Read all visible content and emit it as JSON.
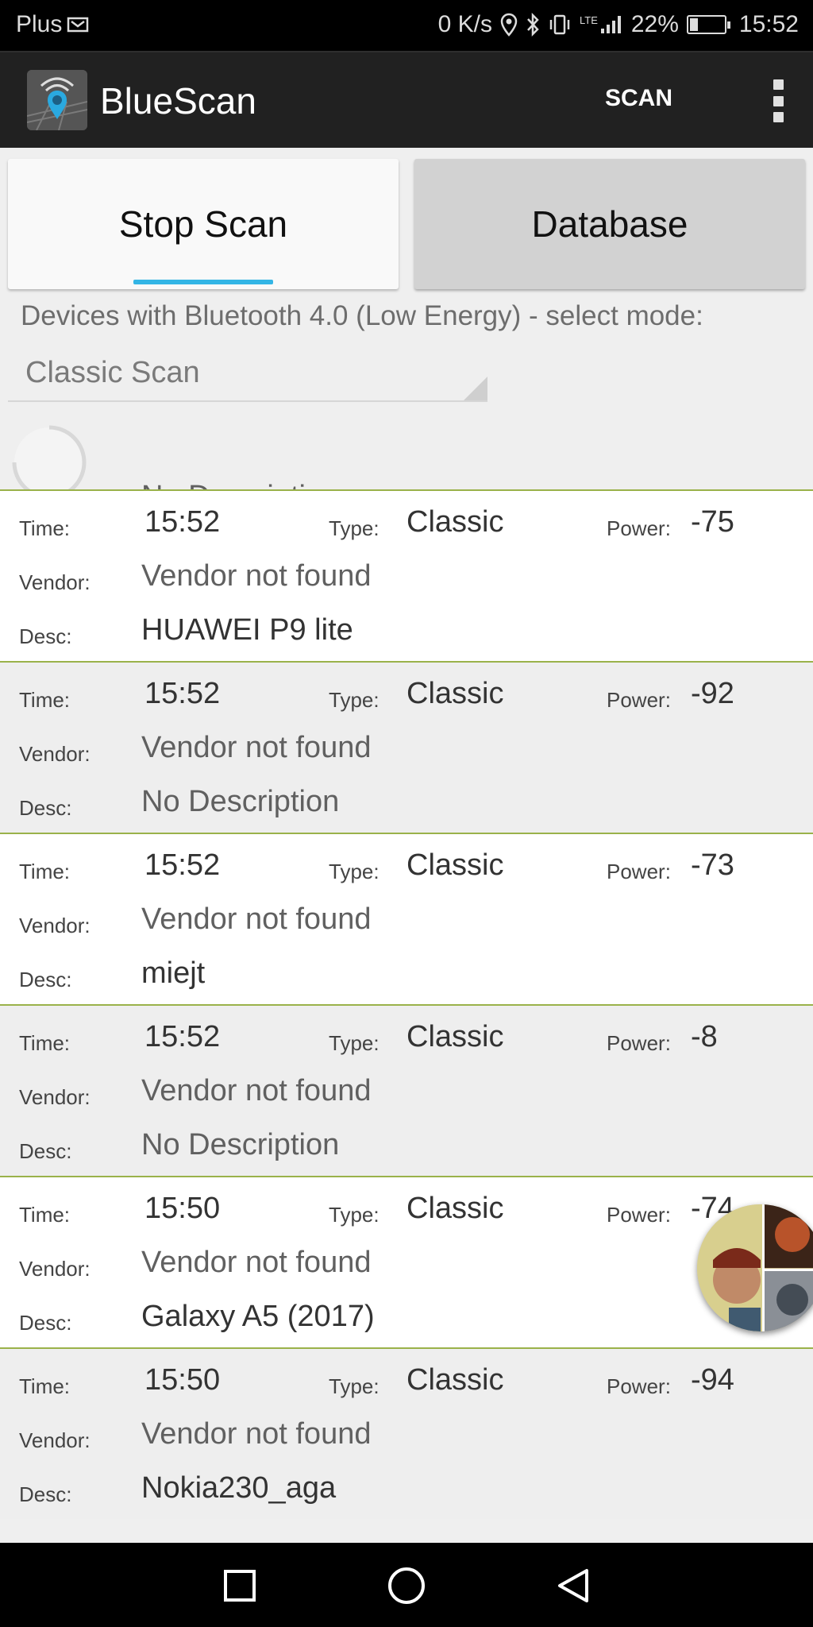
{
  "status_bar": {
    "carrier": "Plus",
    "net_speed": "0 K/s",
    "network": "LTE",
    "battery_percent": "22%",
    "battery_level": 0.22,
    "time": "15:52",
    "icons": [
      "notification-icon",
      "location-icon",
      "bluetooth-icon",
      "vibrate-icon",
      "signal-icon",
      "battery-icon"
    ]
  },
  "app_bar": {
    "title": "BlueScan",
    "scan_label": "SCAN",
    "icon": "bluescan-app-icon",
    "menu_icon": "overflow-menu-icon"
  },
  "tabs": {
    "stop_scan": "Stop Scan",
    "database": "Database",
    "accent_color": "#33b5e5"
  },
  "mode": {
    "label": "Devices with Bluetooth 4.0 (Low Energy) - select mode:",
    "selected": "Classic Scan"
  },
  "list": {
    "labels": {
      "time": "Time:",
      "type": "Type:",
      "power": "Power:",
      "vendor": "Vendor:",
      "desc": "Desc:"
    },
    "partial_top_desc": "No Description",
    "divider_color": "#9ab24a",
    "rows": [
      {
        "time": "15:52",
        "type": "Classic",
        "power": "-75",
        "vendor": "Vendor not found",
        "desc": "HUAWEI P9 lite"
      },
      {
        "time": "15:52",
        "type": "Classic",
        "power": "-92",
        "vendor": "Vendor not found",
        "desc": "No Description"
      },
      {
        "time": "15:52",
        "type": "Classic",
        "power": "-73",
        "vendor": "Vendor not found",
        "desc": "miejt"
      },
      {
        "time": "15:52",
        "type": "Classic",
        "power": "-8",
        "vendor": "Vendor not found",
        "desc": "No Description"
      },
      {
        "time": "15:50",
        "type": "Classic",
        "power": "-74",
        "vendor": "Vendor not found",
        "desc": "Galaxy A5 (2017)"
      },
      {
        "time": "15:50",
        "type": "Classic",
        "power": "-94",
        "vendor": "Vendor not found",
        "desc": "Nokia230_aga"
      }
    ]
  },
  "nav_bar": {
    "icons": [
      "recents-icon",
      "home-icon",
      "back-icon"
    ]
  }
}
